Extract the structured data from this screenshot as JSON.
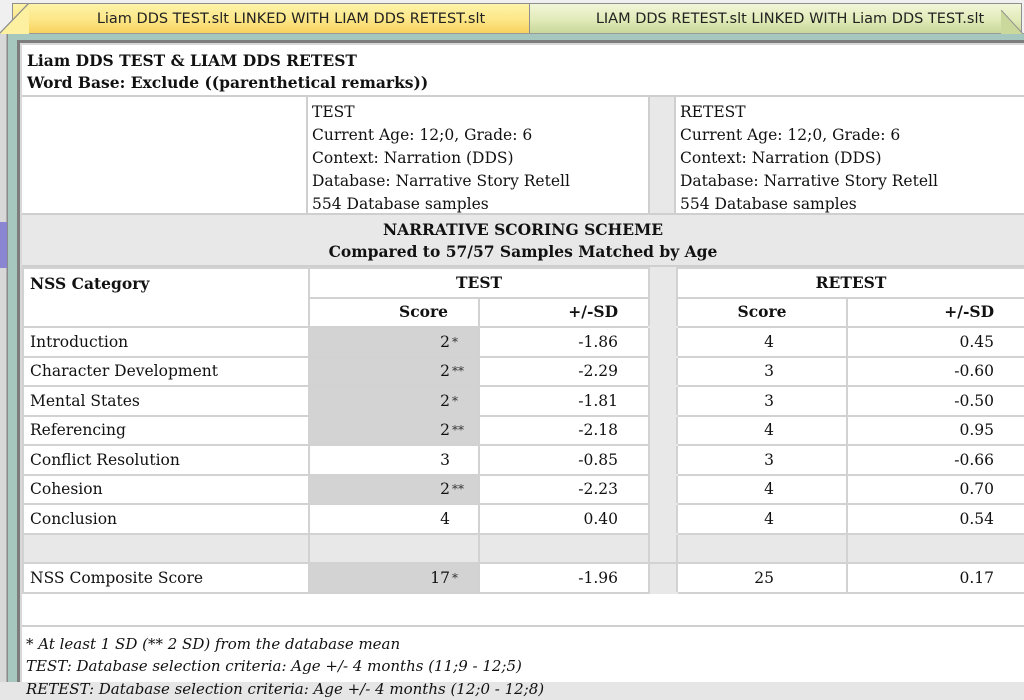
{
  "tabs": [
    {
      "label": "Liam DDS TEST.slt LINKED WITH LIAM DDS RETEST.slt",
      "active": true
    },
    {
      "label": "LIAM DDS RETEST.slt LINKED WITH Liam DDS TEST.slt",
      "active": false
    }
  ],
  "report": {
    "title": "Liam DDS TEST & LIAM DDS RETEST",
    "word_base": "Word Base: Exclude ((parenthetical remarks))",
    "test_info": {
      "label": "TEST",
      "age_grade": "Current Age: 12;0, Grade: 6",
      "context": "Context: Narration (DDS)",
      "database": "Database: Narrative Story Retell",
      "samples": "554 Database samples"
    },
    "retest_info": {
      "label": "RETEST",
      "age_grade": "Current Age: 12;0, Grade: 6",
      "context": "Context: Narration (DDS)",
      "database": "Database: Narrative Story Retell",
      "samples": "554 Database samples"
    },
    "scheme_title": "NARRATIVE SCORING SCHEME",
    "scheme_subtitle": "Compared to 57/57 Samples Matched by Age",
    "headers": {
      "category": "NSS Category",
      "test": "TEST",
      "retest": "RETEST",
      "score": "Score",
      "sd": "+/-SD"
    },
    "rows": [
      {
        "category": "Introduction",
        "test_score": "2",
        "test_flag": "*",
        "test_sd": "-1.86",
        "retest_score": "4",
        "retest_sd": "0.45"
      },
      {
        "category": "Character Development",
        "test_score": "2",
        "test_flag": "**",
        "test_sd": "-2.29",
        "retest_score": "3",
        "retest_sd": "-0.60"
      },
      {
        "category": "Mental States",
        "test_score": "2",
        "test_flag": "*",
        "test_sd": "-1.81",
        "retest_score": "3",
        "retest_sd": "-0.50"
      },
      {
        "category": "Referencing",
        "test_score": "2",
        "test_flag": "**",
        "test_sd": "-2.18",
        "retest_score": "4",
        "retest_sd": "0.95"
      },
      {
        "category": "Conflict Resolution",
        "test_score": "3",
        "test_flag": "",
        "test_sd": "-0.85",
        "retest_score": "3",
        "retest_sd": "-0.66"
      },
      {
        "category": "Cohesion",
        "test_score": "2",
        "test_flag": "**",
        "test_sd": "-2.23",
        "retest_score": "4",
        "retest_sd": "0.70"
      },
      {
        "category": "Conclusion",
        "test_score": "4",
        "test_flag": "",
        "test_sd": "0.40",
        "retest_score": "4",
        "retest_sd": "0.54"
      }
    ],
    "composite": {
      "category": "NSS Composite Score",
      "test_score": "17",
      "test_flag": "*",
      "test_sd": "-1.96",
      "retest_score": "25",
      "retest_sd": "0.17"
    },
    "footnotes": [
      "* At least 1 SD (** 2 SD) from the database mean",
      "TEST: Database selection criteria: Age +/- 4 months (11;9 - 12;5)",
      "RETEST: Database selection criteria: Age +/- 4 months (12;0 - 12;8)"
    ]
  },
  "colors": {
    "active_tab": "#fde88a",
    "inactive_tab": "#e1eab8",
    "flagged_cell": "#d3d3d3",
    "frame": "#a6c7bd",
    "side_accent": "#8a86d2"
  }
}
